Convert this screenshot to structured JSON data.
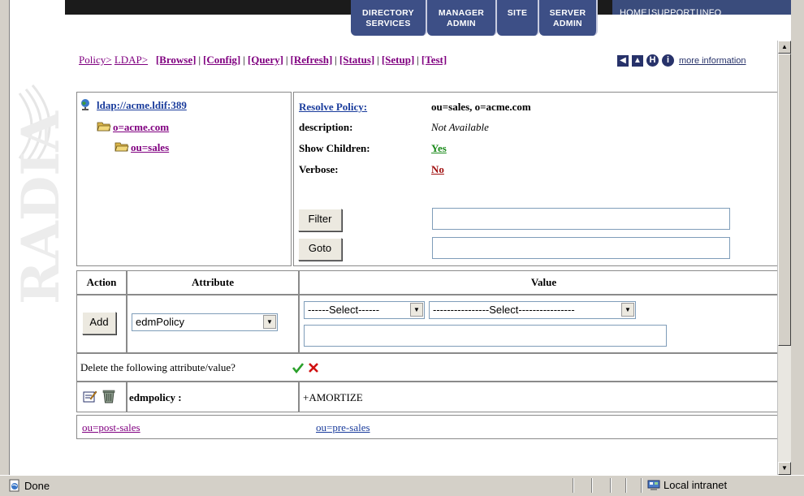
{
  "header": {
    "tabs": [
      {
        "line1": "DIRECTORY",
        "line2": "SERVICES"
      },
      {
        "line1": "MANAGER",
        "line2": "ADMIN"
      },
      {
        "line1": "SITE",
        "line2": ""
      },
      {
        "line1": "SERVER",
        "line2": "ADMIN"
      }
    ],
    "top_links": {
      "home": "HOME",
      "support": "SUPPORT",
      "info": "INFO",
      "sep": "|"
    }
  },
  "watermark": {
    "text": "RADIA"
  },
  "breadcrumb": {
    "policy": "Policy>",
    "ldap": "LDAP>",
    "actions": [
      "[Browse]",
      "[Config]",
      "[Query]",
      "[Refresh]",
      "[Status]",
      "[Setup]",
      "[Test]"
    ],
    "sep": "|"
  },
  "nav": {
    "more_info": "more information"
  },
  "tree": {
    "root": "ldap://acme.ldif:389",
    "org": "o=acme.com",
    "ou": "ou=sales"
  },
  "properties": {
    "resolve_policy_label": "Resolve Policy:",
    "resolve_policy_value": "ou=sales, o=acme.com",
    "description_label": "description:",
    "description_value": "Not Available",
    "show_children_label": "Show Children:",
    "show_children_value": "Yes",
    "verbose_label": "Verbose:",
    "verbose_value": "No",
    "filter_button": "Filter",
    "goto_button": "Goto",
    "filter_value": "",
    "goto_value": ""
  },
  "table": {
    "headers": {
      "action": "Action",
      "attribute": "Attribute",
      "value": "Value"
    },
    "add_button": "Add",
    "attribute_select": "edmPolicy",
    "value_select_1": "------Select------",
    "value_select_2": "----------------Select----------------",
    "value_input": "",
    "delete_prompt": "Delete the following attribute/value?",
    "attr_name": "edmpolicy :",
    "attr_value": "+AMORTIZE"
  },
  "children": [
    {
      "label": "ou=post-sales",
      "color": "#800080"
    },
    {
      "label": "ou=pre-sales",
      "color": "#1a3c9c"
    }
  ],
  "statusbar": {
    "status": "Done",
    "zone": "Local intranet"
  },
  "colors": {
    "accent": "#3d4f86",
    "yes": "#1a8a1a",
    "no": "#a01010",
    "check": "#2aa02a",
    "cross": "#d01010"
  }
}
